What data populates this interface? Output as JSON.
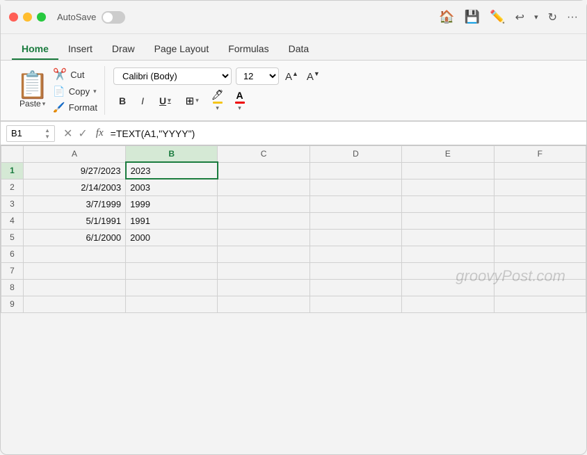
{
  "titlebar": {
    "autosave_label": "AutoSave"
  },
  "tabs": [
    {
      "label": "Home",
      "active": true
    },
    {
      "label": "Insert",
      "active": false
    },
    {
      "label": "Draw",
      "active": false
    },
    {
      "label": "Page Layout",
      "active": false
    },
    {
      "label": "Formulas",
      "active": false
    },
    {
      "label": "Data",
      "active": false
    }
  ],
  "ribbon": {
    "paste_label": "Paste",
    "cut_label": "Cut",
    "copy_label": "Copy",
    "copy_dropdown": "▾",
    "format_label": "Format",
    "font_name": "Calibri (Body)",
    "font_size": "12",
    "bold_label": "B",
    "italic_label": "I",
    "underline_label": "U"
  },
  "formulabar": {
    "cell_ref": "B1",
    "formula": "=TEXT(A1,\"YYYY\")",
    "fx_label": "fx"
  },
  "columns": [
    "",
    "A",
    "B",
    "C",
    "D",
    "E",
    "F"
  ],
  "rows": [
    {
      "num": "1",
      "a": "9/27/2023",
      "b": "2023",
      "active": true
    },
    {
      "num": "2",
      "a": "2/14/2003",
      "b": "2003",
      "active": false
    },
    {
      "num": "3",
      "a": "3/7/1999",
      "b": "1999",
      "active": false
    },
    {
      "num": "4",
      "a": "5/1/1991",
      "b": "1991",
      "active": false
    },
    {
      "num": "5",
      "a": "6/1/2000",
      "b": "2000",
      "active": false
    },
    {
      "num": "6",
      "a": "",
      "b": "",
      "active": false
    },
    {
      "num": "7",
      "a": "",
      "b": "",
      "active": false
    },
    {
      "num": "8",
      "a": "",
      "b": "",
      "active": false
    },
    {
      "num": "9",
      "a": "",
      "b": "",
      "active": false
    }
  ],
  "watermark": "groovyPost.com"
}
